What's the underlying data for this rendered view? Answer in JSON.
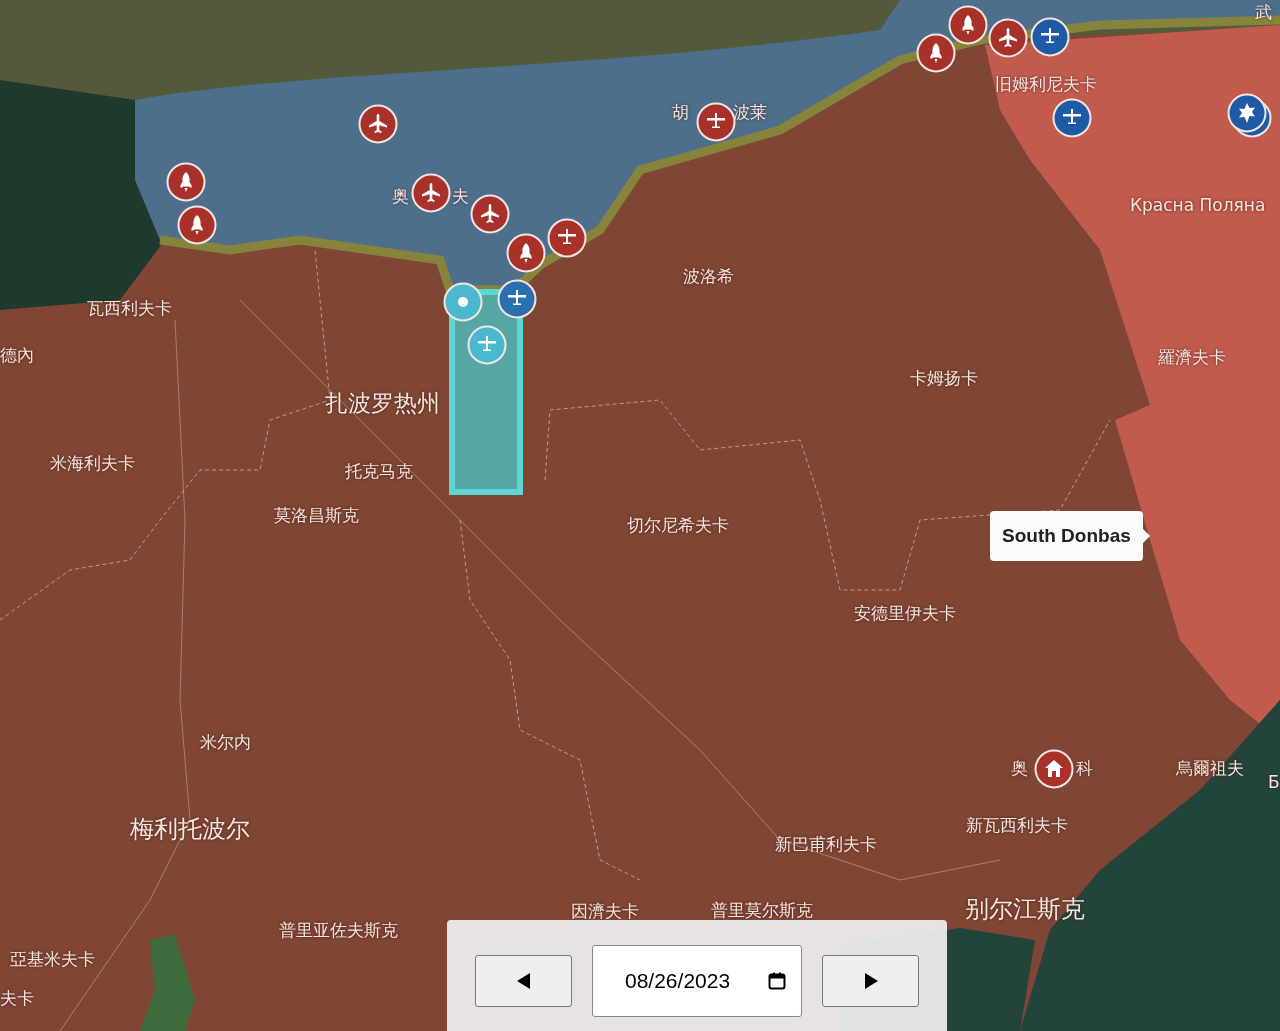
{
  "map": {
    "labels": [
      {
        "text": "武",
        "kind": "town"
      },
      {
        "text": "旧姆利尼夫卡",
        "kind": "town"
      },
      {
        "text": "胡",
        "kind": "town"
      },
      {
        "text": "波莱",
        "kind": "town"
      },
      {
        "text": "奥",
        "kind": "town"
      },
      {
        "text": "夫",
        "kind": "town"
      },
      {
        "text": "Красна Поляна",
        "kind": "town"
      },
      {
        "text": "波洛希",
        "kind": "town"
      },
      {
        "text": "瓦西利夫卡",
        "kind": "town"
      },
      {
        "text": "德內",
        "kind": "town"
      },
      {
        "text": "羅濟夫卡",
        "kind": "town"
      },
      {
        "text": "卡姆扬卡",
        "kind": "town"
      },
      {
        "text": "扎波罗热州",
        "kind": "region"
      },
      {
        "text": "米海利夫卡",
        "kind": "town"
      },
      {
        "text": "托克马克",
        "kind": "town"
      },
      {
        "text": "莫洛昌斯克",
        "kind": "town"
      },
      {
        "text": "切尔尼希夫卡",
        "kind": "town"
      },
      {
        "text": "安德里伊夫卡",
        "kind": "town"
      },
      {
        "text": "米尔内",
        "kind": "town"
      },
      {
        "text": "奥",
        "kind": "town"
      },
      {
        "text": "科",
        "kind": "town"
      },
      {
        "text": "烏爾祖夫",
        "kind": "town"
      },
      {
        "text": "Б",
        "kind": "town"
      },
      {
        "text": "梅利托波尔",
        "kind": "city"
      },
      {
        "text": "新瓦西利夫卡",
        "kind": "town"
      },
      {
        "text": "新巴甫利夫卡",
        "kind": "town"
      },
      {
        "text": "因濟夫卡",
        "kind": "town"
      },
      {
        "text": "普里莫尔斯克",
        "kind": "town"
      },
      {
        "text": "别尔江斯克",
        "kind": "city"
      },
      {
        "text": "普里亚佐夫斯克",
        "kind": "town"
      },
      {
        "text": "亞基米夫卡",
        "kind": "town"
      },
      {
        "text": "夫卡",
        "kind": "town"
      }
    ],
    "markers": [
      {
        "kind": "aircraft",
        "color": "#a8322a"
      },
      {
        "kind": "rocket",
        "color": "#a8322a"
      },
      {
        "kind": "rocket",
        "color": "#a8322a"
      },
      {
        "kind": "aircraft",
        "color": "#a8322a"
      },
      {
        "kind": "rocket",
        "color": "#a8322a"
      },
      {
        "kind": "aircraft",
        "color": "#a8322a"
      },
      {
        "kind": "drone",
        "color": "#a8322a"
      },
      {
        "kind": "drone",
        "color": "#a8322a"
      },
      {
        "kind": "rocket",
        "color": "#a8322a"
      },
      {
        "kind": "rocket",
        "color": "#a8322a"
      },
      {
        "kind": "aircraft",
        "color": "#a8322a"
      },
      {
        "kind": "drone",
        "color": "#1f5aa6"
      },
      {
        "kind": "drone",
        "color": "#1f5aa6"
      },
      {
        "kind": "star",
        "color": "#1f5aa6"
      },
      {
        "kind": "home",
        "color": "#a8322a"
      },
      {
        "kind": "point",
        "color": "#4ab8cf"
      },
      {
        "kind": "drone",
        "color": "#2a6fb0"
      },
      {
        "kind": "drone",
        "color": "#4ab8cf"
      }
    ],
    "tooltip": "South Donbas"
  },
  "date_control": {
    "date": "08/26/2023"
  }
}
